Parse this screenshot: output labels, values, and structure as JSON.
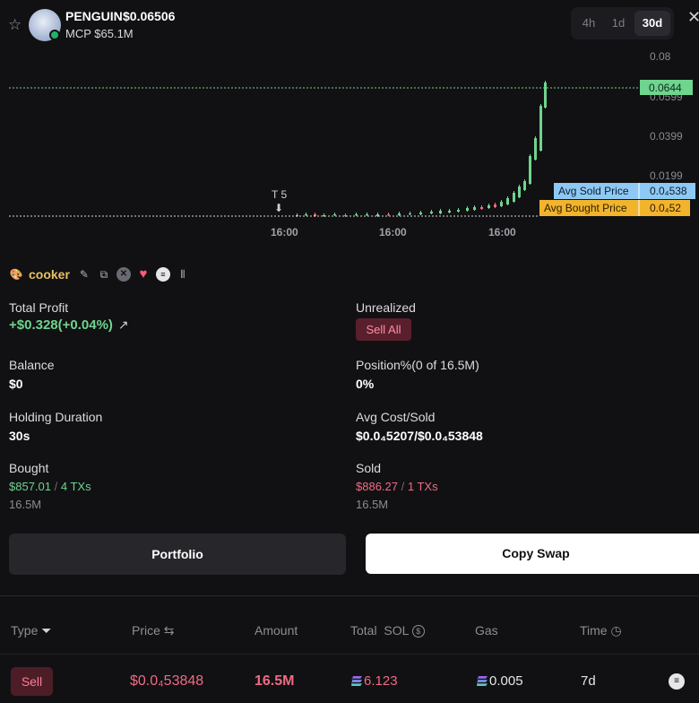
{
  "header": {
    "token_name": "PENGUIN",
    "price": "$0.06506",
    "mcp": "MCP $65.1M",
    "star_icon": "star-icon",
    "timeframes": [
      "4h",
      "1d",
      "30d"
    ],
    "active_timeframe": "30d",
    "close_icon": "close-icon"
  },
  "chart_data": {
    "type": "candlestick",
    "y_ticks": [
      "0.08",
      "0.0599",
      "0.0399",
      "0.0199"
    ],
    "x_ticks": [
      "16:00",
      "16:00",
      "16:00"
    ],
    "current_price_label": "0.0644",
    "avg_sold_label": "Avg Sold Price",
    "avg_sold_value": "0.0₄538",
    "avg_bought_label": "Avg Bought Price",
    "avg_bought_value": "0.0₄52",
    "marker_label": "T 5",
    "colors": {
      "up": "#6fd48e",
      "down": "#f06a85",
      "price_line": "#6fd48e",
      "sold_tag": "#8ec9f5",
      "bought_tag": "#f2b42c"
    }
  },
  "wallet": {
    "name": "cooker",
    "icons": [
      "palette-icon",
      "edit-icon",
      "copy-icon",
      "x-icon",
      "heart-icon",
      "menu-icon",
      "candles-icon"
    ]
  },
  "stats": {
    "total_profit_label": "Total Profit",
    "total_profit_value": "+$0.328(+0.04%)",
    "unrealized_label": "Unrealized",
    "sell_all": "Sell All",
    "balance_label": "Balance",
    "balance_value": "$0",
    "position_label": "Position%(0 of 16.5M)",
    "position_value": "0%",
    "holding_label": "Holding Duration",
    "holding_value": "30s",
    "avg_cost_label": "Avg Cost/Sold",
    "avg_cost_value": "$0.0₄5207/$0.0₄53848",
    "bought_label": "Bought",
    "bought_usd": "$857.01",
    "bought_sep": "/",
    "bought_txs": "4 TXs",
    "bought_amount": "16.5M",
    "sold_label": "Sold",
    "sold_usd": "$886.27",
    "sold_sep": "/",
    "sold_txs": "1 TXs",
    "sold_amount": "16.5M"
  },
  "buttons": {
    "portfolio": "Portfolio",
    "copy_swap": "Copy Swap"
  },
  "table": {
    "headers": {
      "type": "Type",
      "price": "Price",
      "amount": "Amount",
      "total": "Total",
      "total_unit": "SOL",
      "gas": "Gas",
      "time": "Time"
    },
    "rows": [
      {
        "type": "Sell",
        "price": "$0.0₄53848",
        "amount": "16.5M",
        "total": "6.123",
        "gas": "0.005",
        "time": "7d"
      }
    ]
  }
}
